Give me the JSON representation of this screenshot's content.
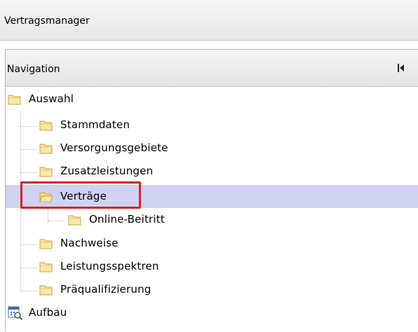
{
  "app": {
    "title": "Vertragsmanager"
  },
  "navigation": {
    "title": "Navigation",
    "collapse_icon": "collapse-left-icon",
    "tree": {
      "root": {
        "label": "Auswahl",
        "icon": "folder-open-icon"
      },
      "items": [
        {
          "label": "Stammdaten",
          "icon": "folder-icon"
        },
        {
          "label": "Versorgungsgebiete",
          "icon": "folder-icon"
        },
        {
          "label": "Zusatzleistungen",
          "icon": "folder-icon"
        },
        {
          "label": "Verträge",
          "icon": "folder-open-icon",
          "selected": true
        },
        {
          "label": "Online-Beitritt",
          "icon": "folder-icon",
          "child_of": "Verträge"
        },
        {
          "label": "Nachweise",
          "icon": "folder-icon"
        },
        {
          "label": "Leistungsspektren",
          "icon": "folder-icon"
        },
        {
          "label": "Präqualifizierung",
          "icon": "folder-icon"
        }
      ],
      "bottom": {
        "label": "Aufbau",
        "icon": "calendar-search-icon"
      }
    },
    "colors": {
      "selection": "#cfd3f1",
      "highlight_border": "#e01e25",
      "folder_fill": "#fbe7a6",
      "folder_stroke": "#c8a340"
    }
  }
}
